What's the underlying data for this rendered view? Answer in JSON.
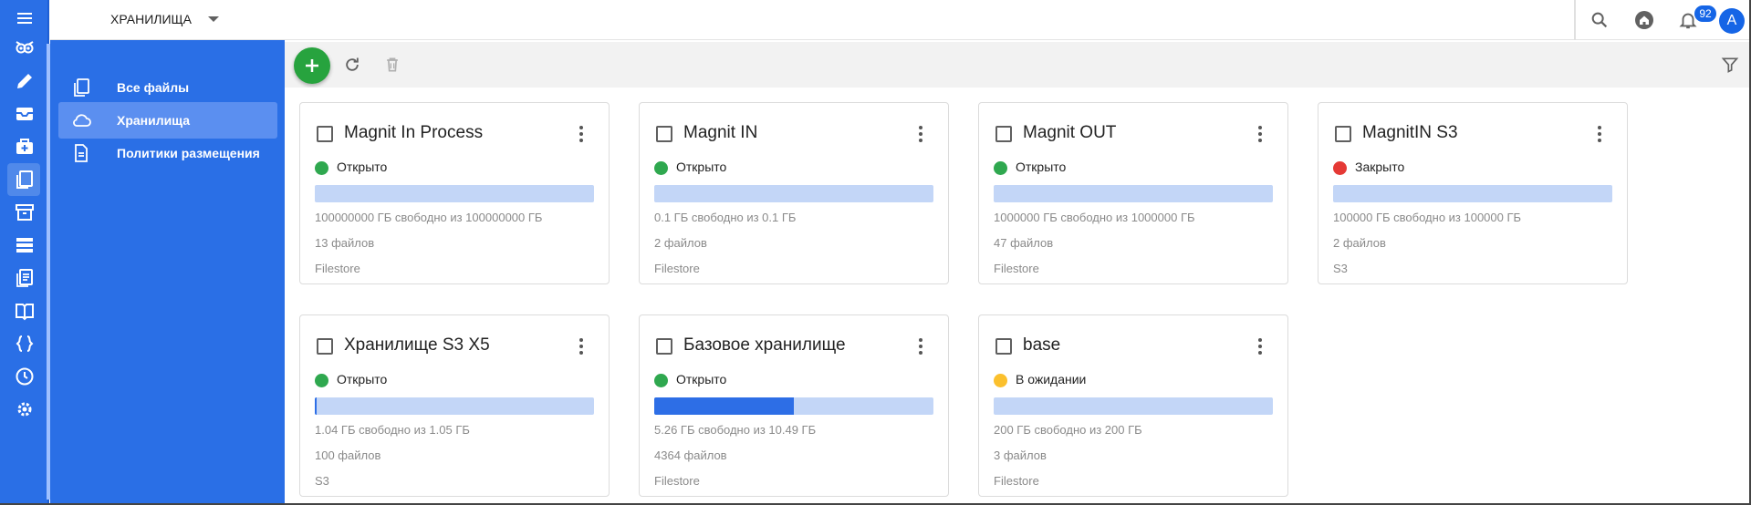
{
  "header": {
    "breadcrumb": "ХРАНИЛИЩА",
    "notifications_count": "92",
    "avatar_letter": "A"
  },
  "rail": {
    "icons": [
      "menu-icon",
      "owl-logo-icon",
      "edit-icon",
      "inbox-icon",
      "medical-bag-icon",
      "files-icon",
      "archive-icon",
      "storage-icon",
      "document-list-icon",
      "book-icon",
      "code-braces-icon",
      "clock-icon",
      "settings-icon"
    ]
  },
  "sidebar": {
    "items": [
      {
        "label": "Все файлы",
        "icon": "files-icon"
      },
      {
        "label": "Хранилища",
        "icon": "cloud-icon"
      },
      {
        "label": "Политики размещения",
        "icon": "document-icon"
      }
    ]
  },
  "colors": {
    "primary": "#2a6fe6",
    "accent_green": "#27a33e",
    "status_open": "#2fa84f",
    "status_closed": "#e53935",
    "status_pending": "#fbc02d",
    "bar_track": "#c3d6f7",
    "bar_fill": "#2d6ee6"
  },
  "cards": [
    {
      "title": "Magnit In Process",
      "status": "Открыто",
      "status_color": "#2fa84f",
      "used_fraction": 0.0,
      "free": "100000000 ГБ свободно из 100000000 ГБ",
      "files": "13 файлов",
      "type": "Filestore"
    },
    {
      "title": "Magnit IN",
      "status": "Открыто",
      "status_color": "#2fa84f",
      "used_fraction": 0.0,
      "free": "0.1 ГБ свободно из 0.1 ГБ",
      "files": "2 файлов",
      "type": "Filestore"
    },
    {
      "title": "Magnit OUT",
      "status": "Открыто",
      "status_color": "#2fa84f",
      "used_fraction": 0.0,
      "free": "1000000 ГБ свободно из 1000000 ГБ",
      "files": "47 файлов",
      "type": "Filestore"
    },
    {
      "title": "MagnitIN S3",
      "status": "Закрыто",
      "status_color": "#e53935",
      "used_fraction": 0.0,
      "free": "100000 ГБ свободно из 100000 ГБ",
      "files": "2 файлов",
      "type": "S3"
    },
    {
      "title": "Хранилище S3 X5",
      "status": "Открыто",
      "status_color": "#2fa84f",
      "used_fraction": 0.01,
      "free": "1.04 ГБ свободно из 1.05 ГБ",
      "files": "100 файлов",
      "type": "S3"
    },
    {
      "title": "Базовое хранилище",
      "status": "Открыто",
      "status_color": "#2fa84f",
      "used_fraction": 0.5,
      "free": "5.26 ГБ свободно из 10.49 ГБ",
      "files": "4364 файлов",
      "type": "Filestore"
    },
    {
      "title": "base",
      "status": "В ожидании",
      "status_color": "#fbc02d",
      "used_fraction": 0.0,
      "free": "200 ГБ свободно из 200 ГБ",
      "files": "3 файлов",
      "type": "Filestore"
    }
  ]
}
